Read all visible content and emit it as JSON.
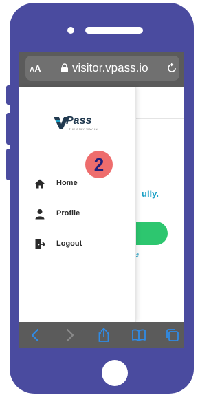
{
  "browser": {
    "text_size_label_small": "A",
    "text_size_label_large": "A",
    "url": "visitor.vpass.io"
  },
  "logo": {
    "brand": "Pass",
    "tagline": "THE ONLY WAY IN"
  },
  "menu": {
    "items": [
      {
        "label": "Home",
        "icon": "home-icon"
      },
      {
        "label": "Profile",
        "icon": "user-icon"
      },
      {
        "label": "Logout",
        "icon": "logout-icon"
      }
    ]
  },
  "background": {
    "partial_text": "ully.",
    "partial_link": "e"
  },
  "annotation": {
    "step": "2"
  },
  "colors": {
    "phone_frame": "#4a4b9f",
    "accent_blue": "#1da1c6",
    "accent_green": "#2dc66f",
    "badge_red": "#ee6d6d",
    "badge_text": "#1f1f7a",
    "browser_chrome": "#5b5b5b",
    "toolbar_icon": "#2f8be6"
  }
}
